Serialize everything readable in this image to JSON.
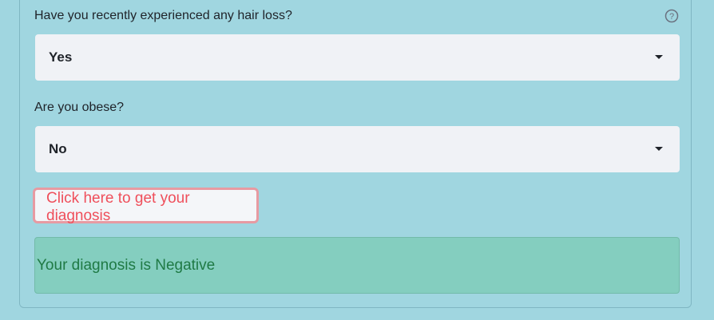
{
  "questions": {
    "hair_loss": {
      "label": "Have you recently experienced any hair loss?",
      "selected": "Yes"
    },
    "obese": {
      "label": "Are you obese?",
      "selected": "No"
    }
  },
  "help_icon_glyph": "?",
  "diagnose_button_label": "Click here to get your diagnosis",
  "result": {
    "text": "Your diagnosis is Negative",
    "status_color": "#84cebf"
  },
  "colors": {
    "background": "#a0d6e0",
    "button_text": "#ef4f5b",
    "button_border": "#e79aa2",
    "result_text": "#1f7a45"
  }
}
